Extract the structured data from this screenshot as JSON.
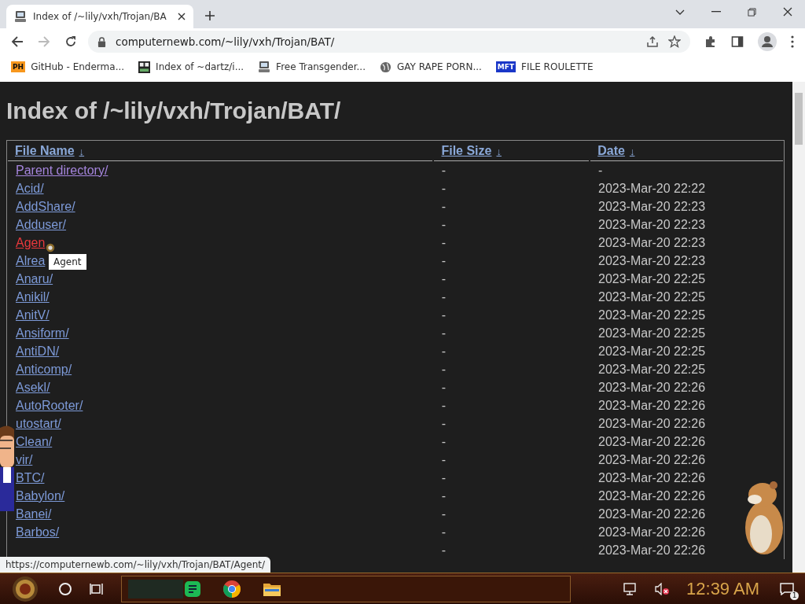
{
  "browser": {
    "tab": {
      "title": "Index of /~lily/vxh/Trojan/BA",
      "selected": true
    },
    "address": "computernewb.com/~lily/vxh/Trojan/BAT/",
    "bookmarks": [
      {
        "kind": "badge",
        "badge": "PH",
        "label": "GitHub - Enderma..."
      },
      {
        "kind": "grid",
        "label": "Index of ~dartz/i..."
      },
      {
        "kind": "computer",
        "label": "Free Transgender..."
      },
      {
        "kind": "globe",
        "label": "GAY RAPE PORN..."
      },
      {
        "kind": "badge",
        "badge": "MFT",
        "label": "FILE ROULETTE"
      }
    ]
  },
  "page": {
    "heading": "Index of /~lily/vxh/Trojan/BAT/",
    "columns": [
      {
        "label": "File Name",
        "sort": "↓"
      },
      {
        "label": "File Size",
        "sort": "↓"
      },
      {
        "label": "Date",
        "sort": "↓"
      }
    ],
    "rows": [
      {
        "name": "Parent directory/",
        "size": "-",
        "date": "-",
        "visited": true,
        "hovered": false
      },
      {
        "name": "Acid/",
        "size": "-",
        "date": "2023-Mar-20 22:22",
        "visited": false,
        "hovered": false
      },
      {
        "name": "AddShare/",
        "size": "-",
        "date": "2023-Mar-20 22:23",
        "visited": false,
        "hovered": false
      },
      {
        "name": "Adduser/",
        "size": "-",
        "date": "2023-Mar-20 22:23",
        "visited": false,
        "hovered": false
      },
      {
        "name": "Agen",
        "size": "-",
        "date": "2023-Mar-20 22:23",
        "visited": false,
        "hovered": true
      },
      {
        "name": "Alrea",
        "size": "-",
        "date": "2023-Mar-20 22:23",
        "visited": false,
        "hovered": false
      },
      {
        "name": "Anaru/",
        "size": "-",
        "date": "2023-Mar-20 22:25",
        "visited": false,
        "hovered": false
      },
      {
        "name": "Anikil/",
        "size": "-",
        "date": "2023-Mar-20 22:25",
        "visited": false,
        "hovered": false
      },
      {
        "name": "AnitV/",
        "size": "-",
        "date": "2023-Mar-20 22:25",
        "visited": false,
        "hovered": false
      },
      {
        "name": "Ansiform/",
        "size": "-",
        "date": "2023-Mar-20 22:25",
        "visited": false,
        "hovered": false
      },
      {
        "name": "AntiDN/",
        "size": "-",
        "date": "2023-Mar-20 22:25",
        "visited": false,
        "hovered": false
      },
      {
        "name": "Anticomp/",
        "size": "-",
        "date": "2023-Mar-20 22:25",
        "visited": false,
        "hovered": false
      },
      {
        "name": "Asekl/",
        "size": "-",
        "date": "2023-Mar-20 22:26",
        "visited": false,
        "hovered": false
      },
      {
        "name": "AutoRooter/",
        "size": "-",
        "date": "2023-Mar-20 22:26",
        "visited": false,
        "hovered": false
      },
      {
        "name": "utostart/",
        "size": "-",
        "date": "2023-Mar-20 22:26",
        "visited": false,
        "hovered": false
      },
      {
        "name": "Clean/",
        "size": "-",
        "date": "2023-Mar-20 22:26",
        "visited": false,
        "hovered": false
      },
      {
        "name": "vir/",
        "size": "-",
        "date": "2023-Mar-20 22:26",
        "visited": false,
        "hovered": false
      },
      {
        "name": "BTC/",
        "size": "-",
        "date": "2023-Mar-20 22:26",
        "visited": false,
        "hovered": false
      },
      {
        "name": "Babylon/",
        "size": "-",
        "date": "2023-Mar-20 22:26",
        "visited": false,
        "hovered": false
      },
      {
        "name": "Banei/",
        "size": "-",
        "date": "2023-Mar-20 22:26",
        "visited": false,
        "hovered": false
      },
      {
        "name": "Barbos/",
        "size": "-",
        "date": "2023-Mar-20 22:26",
        "visited": false,
        "hovered": false
      },
      {
        "size": "-",
        "date": "2023-Mar-20 22:26"
      }
    ],
    "tooltip": "Agent",
    "status_url": "https://computernewb.com/~lily/vxh/Trojan/BAT/Agent/"
  },
  "taskbar": {
    "clock": "12:39 AM",
    "notification_count": "1"
  }
}
